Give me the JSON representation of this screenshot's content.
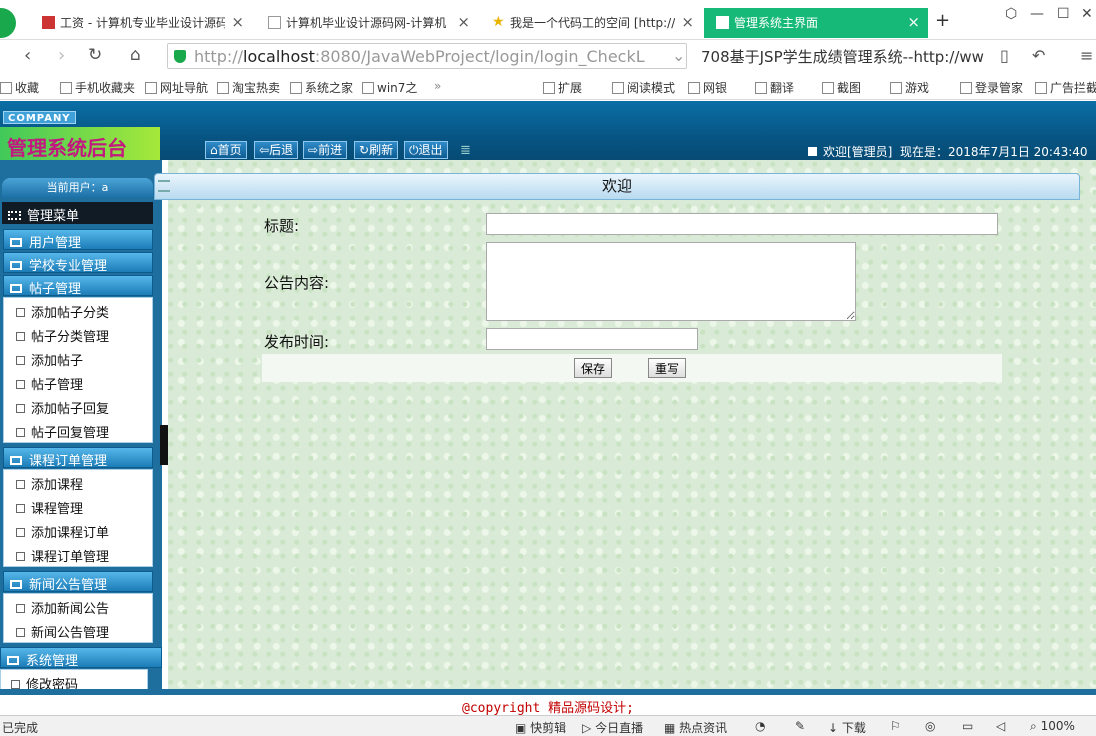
{
  "browser": {
    "tabs": [
      {
        "label": "工资 - 计算机专业毕业设计源码",
        "active": false
      },
      {
        "label": "计算机毕业设计源码网-计算机",
        "active": false
      },
      {
        "label": "我是一个代码工的空间 [http://",
        "active": false
      },
      {
        "label": "管理系统主界面",
        "active": true
      }
    ],
    "address": {
      "protocol": "http://",
      "host": "localhost",
      "path": ":8080/JavaWebProject/login/login_CheckL"
    },
    "search_text": "708基于JSP学生成绩管理系统--http://ww",
    "bookmarks": [
      "收藏",
      "手机收藏夹",
      "网址导航",
      "淘宝热卖",
      "系统之家",
      "win7之",
      "扩展",
      "阅读模式",
      "网银",
      "翻译",
      "截图",
      "游戏",
      "登录管家",
      "广告拦截"
    ]
  },
  "app": {
    "company_tag": "COMPANY",
    "system_name": "管理系统后台",
    "toolbar": {
      "home": "首页",
      "back": "后退",
      "forward": "前进",
      "refresh": "刷新",
      "logout": "退出"
    },
    "welcome_text": "欢迎[管理员]",
    "time_label": "现在是：2018年7月1日 20:43:40"
  },
  "sidebar": {
    "current_user": "当前用户：a",
    "menu_title": "管理菜单",
    "sections": [
      {
        "label": "用户管理",
        "items": []
      },
      {
        "label": "学校专业管理",
        "items": []
      },
      {
        "label": "帖子管理",
        "items": [
          "添加帖子分类",
          "帖子分类管理",
          "添加帖子",
          "帖子管理",
          "添加帖子回复",
          "帖子回复管理"
        ]
      },
      {
        "label": "课程订单管理",
        "items": [
          "添加课程",
          "课程管理",
          "添加课程订单",
          "课程订单管理"
        ]
      },
      {
        "label": "新闻公告管理",
        "items": [
          "添加新闻公告",
          "新闻公告管理"
        ]
      },
      {
        "label": "系统管理",
        "items": [
          "修改密码"
        ]
      }
    ]
  },
  "main": {
    "panel_title": "欢迎",
    "form": {
      "title_label": "标题:",
      "title_value": "",
      "content_label": "公告内容:",
      "content_value": "",
      "time_label": "发布时间:",
      "time_value": "",
      "save_label": "保存",
      "reset_label": "重写"
    }
  },
  "footer": {
    "copyright": "@copyright 精品源码设计;"
  },
  "statusbar": {
    "left": "已完成",
    "items": [
      "快剪辑",
      "今日直播",
      "热点资讯",
      "下载",
      "100%"
    ]
  }
}
